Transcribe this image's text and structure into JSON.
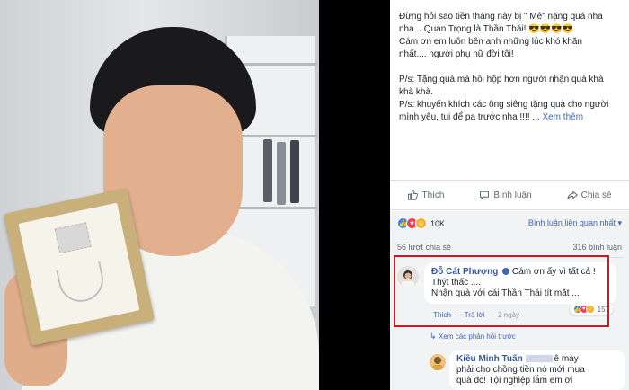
{
  "post": {
    "lines": [
      "Đừng hỏi sao tiền tháng này bị \" Mẻ\" nặng quá nha",
      "nha... Quan Trọng là Thần Thái! 😎😎😎😎",
      "Cám ơn em luôn bên anh những lúc khó khăn",
      "nhất.... người phụ nữ đời tôi!"
    ],
    "ps1a": "P/s: Tặng quà mà hồi hộp hơn người nhận quà khà",
    "ps1b": "khà khà.",
    "ps2a": "P/s: khuyến khích các ông siêng tặng quà cho người",
    "ps2b": "mình yêu, tui để pa trước nha !!!! ...",
    "see_more": "Xem thêm"
  },
  "actions": {
    "like": "Thích",
    "comment": "Bình luận",
    "share": "Chia sẻ"
  },
  "reactions": {
    "count": "10K",
    "sort": "Bình luận liên quan nhất ▾",
    "shares": "56 lượt chia sẻ",
    "comments": "316 bình luận"
  },
  "comment1": {
    "name": "Đỗ Cát Phượng",
    "line1": "Cám ơn ấy vì tất cả !",
    "line2": "Thýt thấc ....",
    "line3": "Nhận quà với cái Thần Thái tít mắt ...",
    "like": "Thích",
    "reply": "Trả lời",
    "time": "2 ngày",
    "react_count": "157"
  },
  "more_replies": "Xem các phản hồi trước",
  "comment2": {
    "name": "Kiều Minh Tuấn",
    "after_blur": "ê mày",
    "line2": "phải cho chồng tiền nó mới mua",
    "line3": "quà đc! Tội nghiệp lắm em ơi"
  },
  "colors": {
    "fb_link": "#4267b2",
    "name": "#365899",
    "highlight": "#c21f26",
    "like": "#2d88ff",
    "love": "#f33e58",
    "haha": "#f7b125"
  }
}
